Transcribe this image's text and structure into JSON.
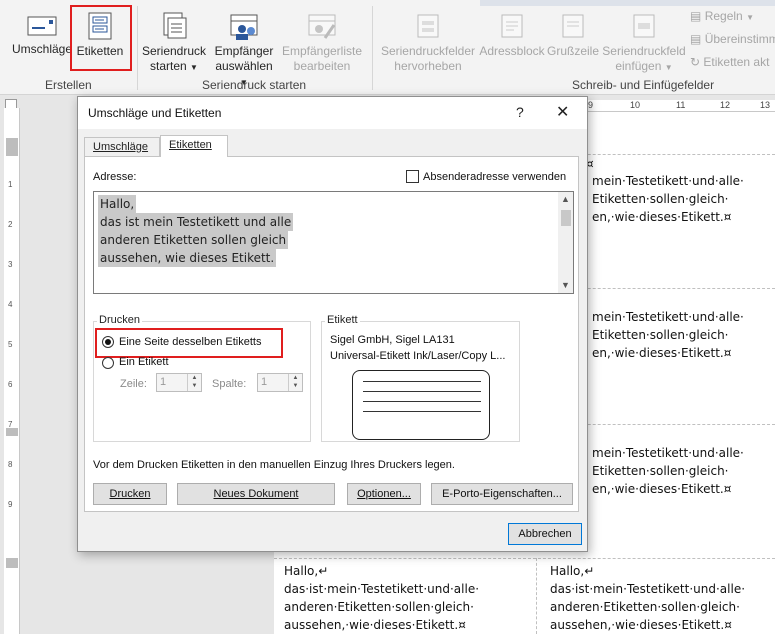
{
  "ribbon": {
    "groups": {
      "create": "Erstellen",
      "start_mail_merge": "Seriendruck starten",
      "write_insert": "Schreib- und Einfügefelder"
    },
    "buttons": {
      "envelopes": "Umschläge",
      "labels": "Etiketten",
      "start_merge_1": "Seriendruck",
      "start_merge_2": "starten",
      "select_recipients_1": "Empfänger",
      "select_recipients_2": "auswählen",
      "edit_list_1": "Empfängerliste",
      "edit_list_2": "bearbeiten",
      "highlight_1": "Seriendruckfelder",
      "highlight_2": "hervorheben",
      "address_block": "Adressblock",
      "greeting": "Grußzeile",
      "insert_field_1": "Seriendruckfeld",
      "insert_field_2": "einfügen",
      "rules": "Regeln",
      "match_fields": "Übereinstimm",
      "update_labels": "Etiketten akt"
    }
  },
  "ruler": {
    "h_ticks": [
      "9",
      "10",
      "11",
      "12",
      "13"
    ],
    "v_ticks": [
      "1",
      "2",
      "3",
      "4",
      "5",
      "6",
      "7",
      "8",
      "9"
    ]
  },
  "document": {
    "label_lines": [
      "Hallo,↵",
      "das·ist·mein·Testetikett·und·alle·",
      "anderen·Etiketten·sollen·gleich·",
      "aussehen,·wie·dieses·Etikett.¤"
    ],
    "right_lines": [
      "mein·Testetikett·und·alle·",
      "Etiketten·sollen·gleich·",
      "en,·wie·dieses·Etikett.¤"
    ],
    "row_marker": "¤"
  },
  "dialog": {
    "title": "Umschläge und Etiketten",
    "help": "?",
    "close": "✕",
    "tabs": [
      "Umschläge",
      "Etiketten"
    ],
    "address_label": "Adresse:",
    "use_return_address": "Absenderadresse verwenden",
    "address_lines": [
      "Hallo,",
      "das ist mein Testetikett und alle",
      "anderen Etiketten sollen gleich",
      "aussehen, wie dieses Etikett."
    ],
    "print_group": "Drucken",
    "full_page_option": "Eine Seite desselben Etiketts",
    "single_label_option": "Ein Etikett",
    "row_label": "Zeile:",
    "row_value": "1",
    "column_label": "Spalte:",
    "column_value": "1",
    "label_group": "Etikett",
    "label_vendor": "Sigel GmbH, Sigel LA131",
    "label_product": "Universal-Etikett Ink/Laser/Copy L...",
    "info_text": "Vor dem Drucken Etiketten in den manuellen Einzug Ihres Druckers legen.",
    "buttons": {
      "print": "Drucken",
      "new_document": "Neues Dokument",
      "options": "Optionen...",
      "eporto": "E-Porto-Eigenschaften...",
      "cancel": "Abbrechen"
    }
  },
  "colors": {
    "highlight_red": "#e01e1e",
    "selection_gray": "#c9c9c9",
    "primary_button_border": "#0078d7"
  }
}
